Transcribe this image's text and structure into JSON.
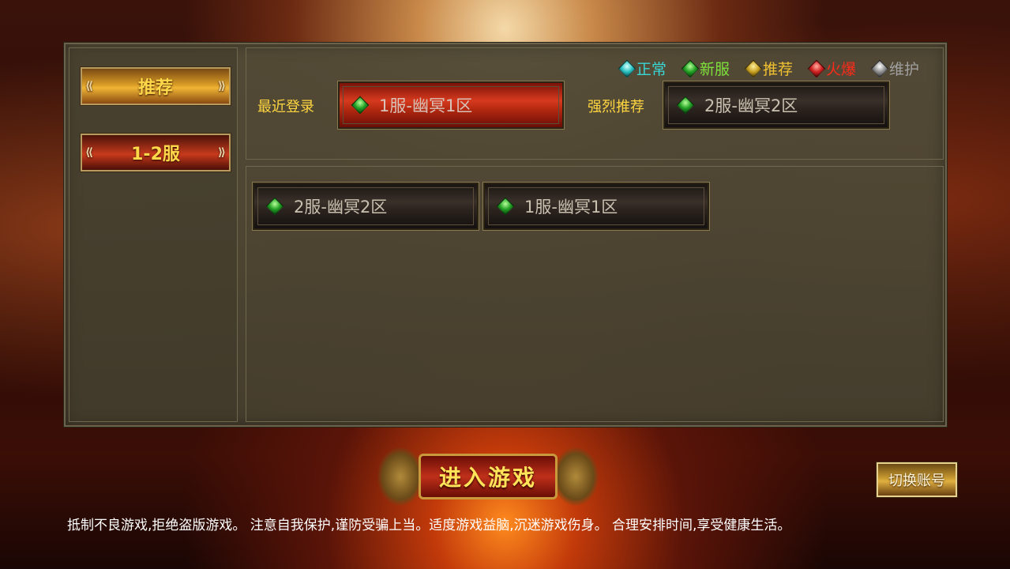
{
  "sidebar": {
    "items": [
      {
        "label": "推荐",
        "state": "active"
      },
      {
        "label": "1-2服",
        "state": "normal"
      }
    ]
  },
  "legend": [
    {
      "label": "正常",
      "color": "#39d6d6",
      "icon": "cyan-gem-icon"
    },
    {
      "label": "新服",
      "color": "#7ee03a",
      "icon": "green-gem-icon"
    },
    {
      "label": "推荐",
      "color": "#f0c030",
      "icon": "gold-gem-icon"
    },
    {
      "label": "火爆",
      "color": "#ff2a1a",
      "icon": "red-gem-icon"
    },
    {
      "label": "维护",
      "color": "#a0a0a0",
      "icon": "grey-gem-icon"
    }
  ],
  "recent": {
    "label": "最近登录",
    "server": "1服-幽冥1区"
  },
  "recommend": {
    "label": "强烈推荐",
    "server": "2服-幽冥2区"
  },
  "server_list": [
    {
      "name": "2服-幽冥2区"
    },
    {
      "name": "1服-幽冥1区"
    }
  ],
  "enter_button": "进入游戏",
  "switch_account_button": "切换账号",
  "health_notice": "抵制不良游戏,拒绝盗版游戏。 注意自我保护,谨防受骗上当。适度游戏益脑,沉迷游戏伤身。 合理安排时间,享受健康生活。"
}
